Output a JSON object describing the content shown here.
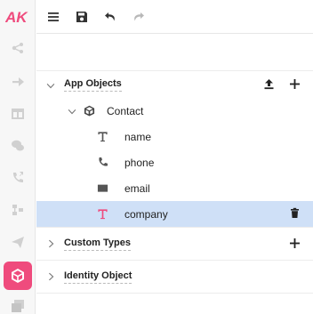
{
  "brand": {
    "accent": "#ef4b7d",
    "selected_bg": "#cfe0f7",
    "logo_text": "AK"
  },
  "rail": {
    "icons": [
      "flow-icon",
      "arrow-right-icon",
      "table-icon",
      "chat-icon",
      "phone-forward-icon",
      "relations-icon",
      "send-icon",
      "objects-icon",
      "gallery-icon"
    ],
    "active": "objects-icon"
  },
  "toolbar": {
    "menu": "menu-icon",
    "save": "save-icon",
    "undo": "undo-icon",
    "redo": "redo-icon"
  },
  "tree": {
    "app_objects": {
      "label": "App Objects",
      "object": {
        "label": "Contact",
        "fields": [
          {
            "label": "name",
            "icon": "text-type-icon"
          },
          {
            "label": "phone",
            "icon": "phone-icon"
          },
          {
            "label": "email",
            "icon": "envelope-icon"
          },
          {
            "label": "company",
            "icon": "text-type-icon",
            "selected": true
          }
        ]
      }
    },
    "custom_types": {
      "label": "Custom Types"
    },
    "identity_object": {
      "label": "Identity Object"
    }
  }
}
